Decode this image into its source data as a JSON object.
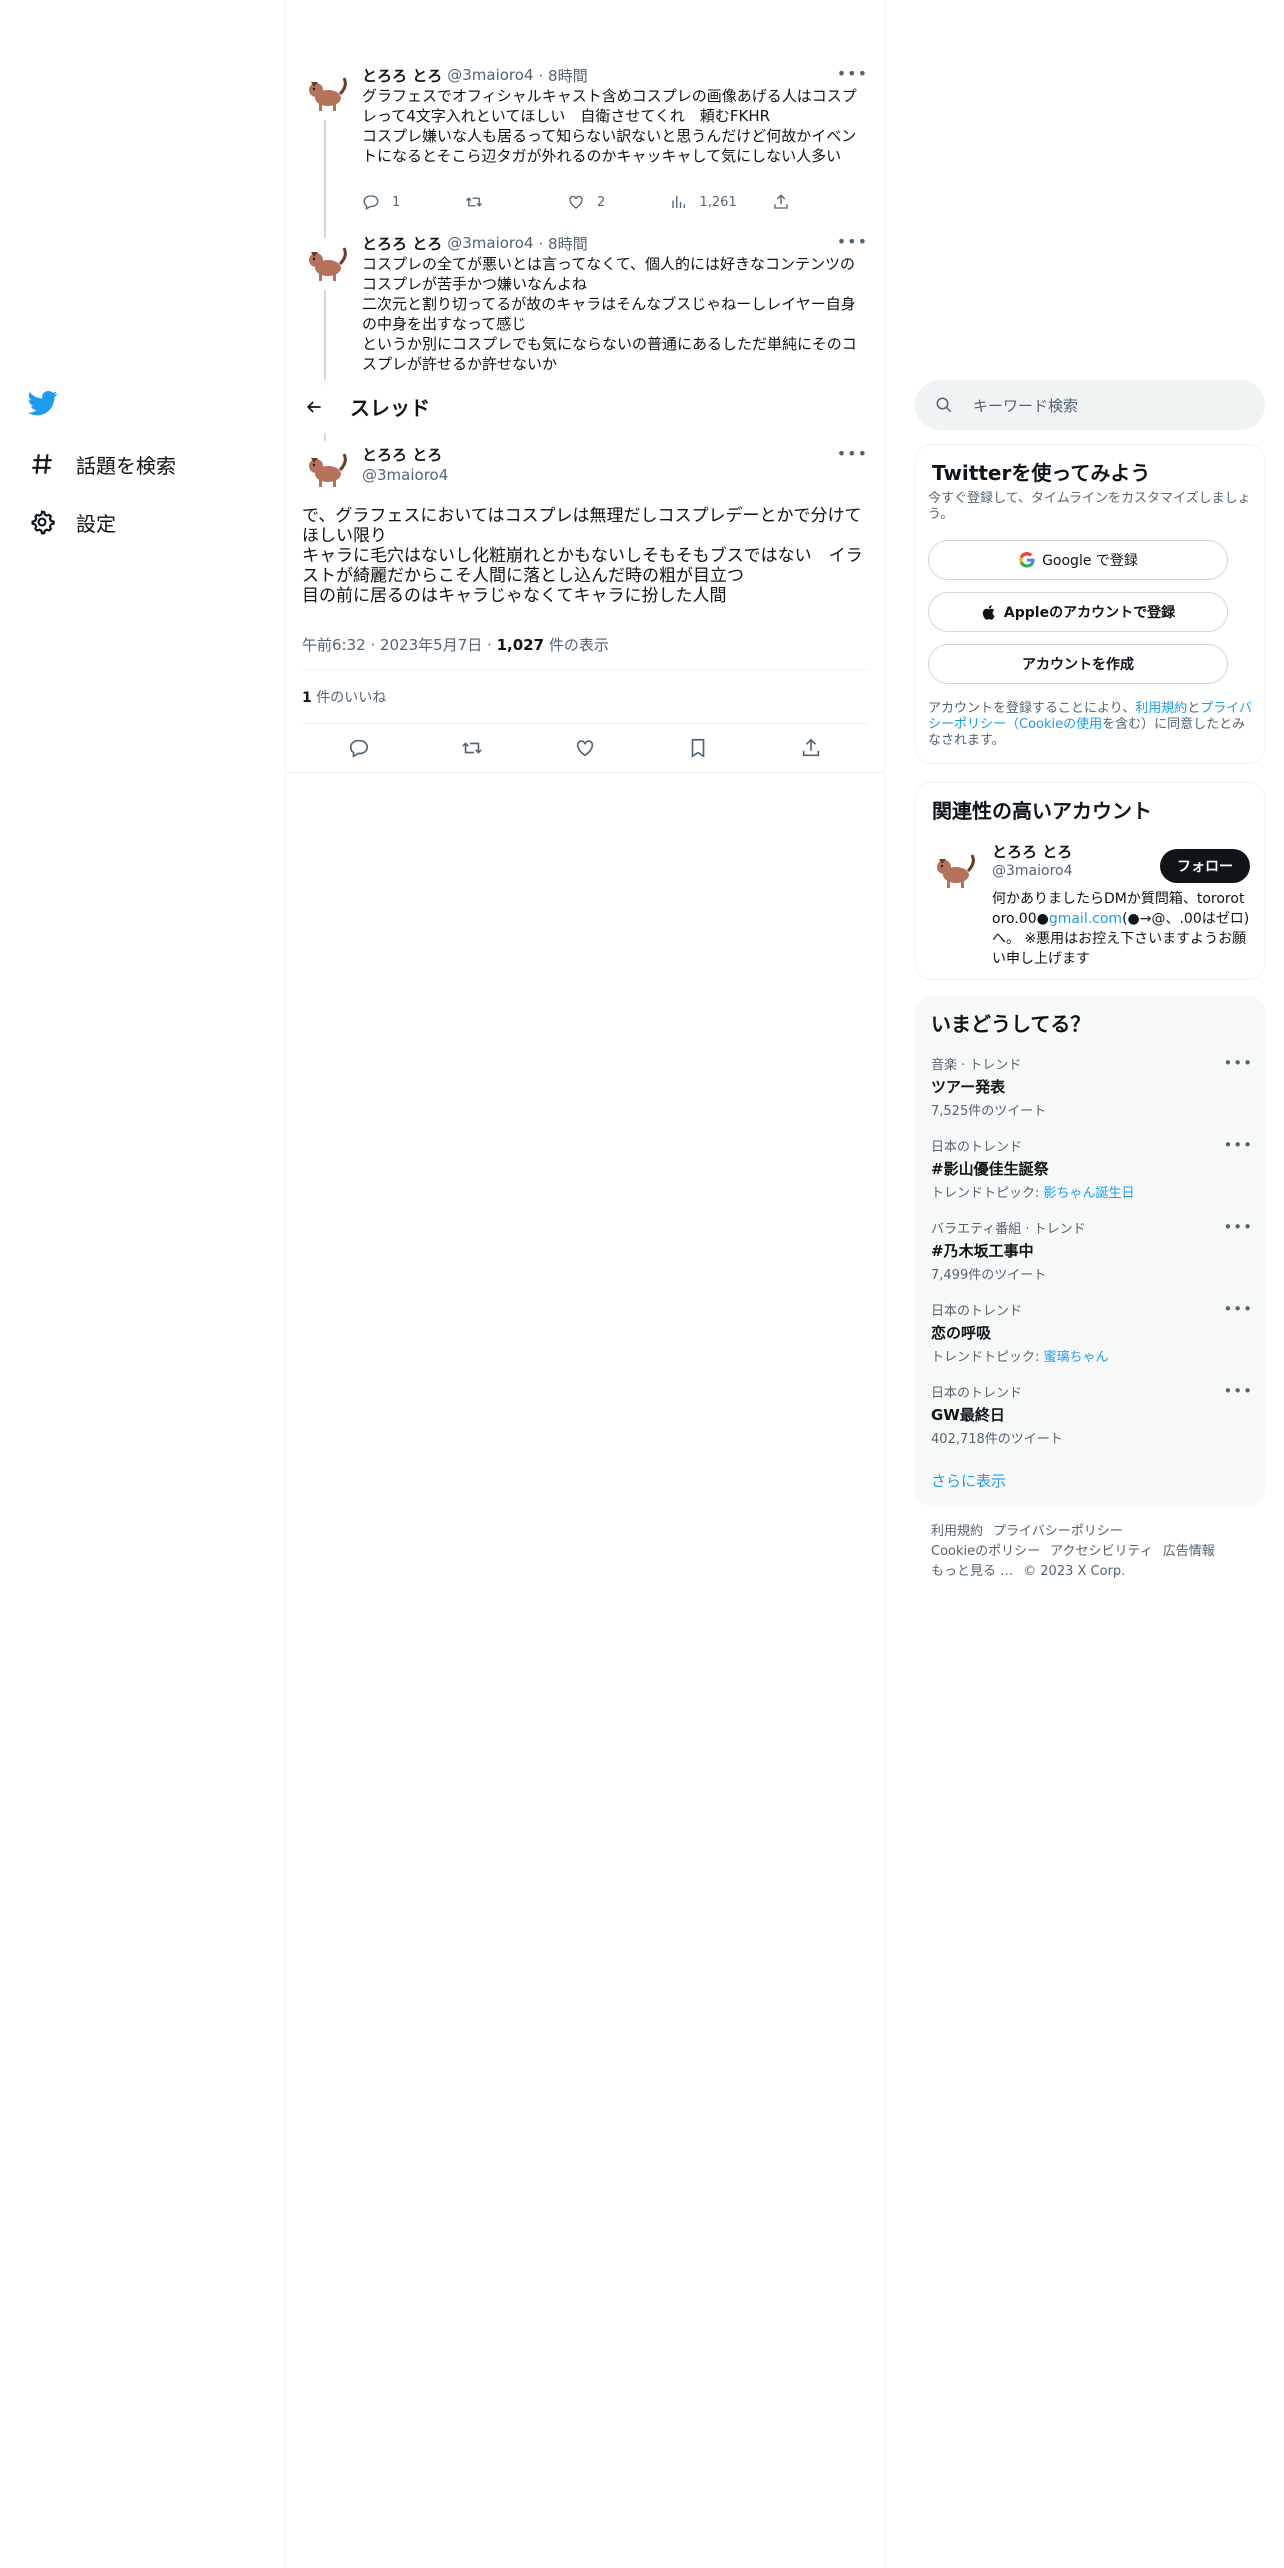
{
  "nav": {
    "items": [
      {
        "label": "話題を検索",
        "icon": "hashtag-icon"
      },
      {
        "label": "設定",
        "icon": "gear-icon"
      }
    ]
  },
  "tweets": [
    {
      "name": "とろろ とろ",
      "handle": "@3maioro4",
      "time": "· 8時間",
      "body": "グラフェスでオフィシャルキャスト含めコスプレの画像あげる人はコスプレって4文字入れといてほしい　自衛させてくれ　頼むFKHR\nコスプレ嫌いな人も居るって知らない訳ないと思うんだけど何故かイベントになるとそこら辺タガが外れるのかキャッキャして気にしない人多い",
      "replies": "1",
      "retweets": "",
      "likes": "2",
      "views": "1,261"
    },
    {
      "name": "とろろ とろ",
      "handle": "@3maioro4",
      "time": "· 8時間",
      "body": "コスプレの全てが悪いとは言ってなくて、個人的には好きなコンテンツのコスプレが苦手かつ嫌いなんよね\n二次元と割り切ってるが故のキャラはそんなブスじゃねーしレイヤー自身の中身を出すなって感じ\nというか別にコスプレでも気にならないの普通にあるしただ単純にそのコスプレが許せるか許せないか"
    }
  ],
  "thread": {
    "title": "スレッド"
  },
  "main_tweet": {
    "name": "とろろ とろ",
    "handle": "@3maioro4",
    "body": "で、グラフェスにおいてはコスプレは無理だしコスプレデーとかで分けてほしい限り\nキャラに毛穴はないし化粧崩れとかもないしそもそもブスではない　イラストが綺麗だからこそ人間に落とし込んだ時の粗が目立つ\n目の前に居るのはキャラじゃなくてキャラに扮した人間",
    "time": "午前6:32",
    "date": "2023年5月7日",
    "views_count": "1,027",
    "views_label": "件の表示",
    "likes_count": "1",
    "likes_label": "件のいいね"
  },
  "search": {
    "placeholder": "キーワード検索"
  },
  "signup": {
    "title": "Twitterを使ってみよう",
    "subtitle": "今すぐ登録して、タイムラインをカスタマイズしましょう。",
    "google_btn": "Google で登録",
    "apple_btn": "Appleのアカウントで登録",
    "create_btn": "アカウントを作成",
    "terms_pre": "アカウントを登録することにより、",
    "terms_link1": "利用規約",
    "terms_mid1": "と",
    "terms_link2": "プライバシーポリシー（Cookieの使用",
    "terms_post": "を含む）に同意したとみなされます。"
  },
  "related": {
    "title": "関連性の高いアカウント",
    "name": "とろろ とろ",
    "handle": "@3maioro4",
    "follow": "フォロー",
    "bio_pre": "何かありましたらDMか質問箱、tororotoro.00●",
    "bio_link": "gmail.com",
    "bio_post": "(●→@、.00はゼロ)へ。 ※悪用はお控え下さいますようお願い申し上げます"
  },
  "trends": {
    "title": "いまどうしてる？",
    "items": [
      {
        "meta": "音楽 · トレンド",
        "name": "ツアー発表",
        "count": "7,525件のツイート",
        "topic": ""
      },
      {
        "meta": "日本のトレンド",
        "name": "#影山優佳生誕祭",
        "count": "トレンドトピック: ",
        "topic": "影ちゃん誕生日"
      },
      {
        "meta": "バラエティ番組 · トレンド",
        "name": "#乃木坂工事中",
        "count": "7,499件のツイート",
        "topic": ""
      },
      {
        "meta": "日本のトレンド",
        "name": "恋の呼吸",
        "count": "トレンドトピック: ",
        "topic": "蜜璃ちゃん"
      },
      {
        "meta": "日本のトレンド",
        "name": "GW最終日",
        "count": "402,718件のツイート",
        "topic": ""
      }
    ],
    "show_more": "さらに表示"
  },
  "footer": {
    "links": [
      "利用規約",
      "プライバシーポリシー",
      "Cookieのポリシー",
      "アクセシビリティ",
      "広告情報",
      "もっと見る …",
      "© 2023 X Corp."
    ]
  },
  "colors": {
    "accent": "#1d9bf0",
    "text": "#0f1419",
    "muted": "#536471",
    "border": "#eff3f4"
  }
}
